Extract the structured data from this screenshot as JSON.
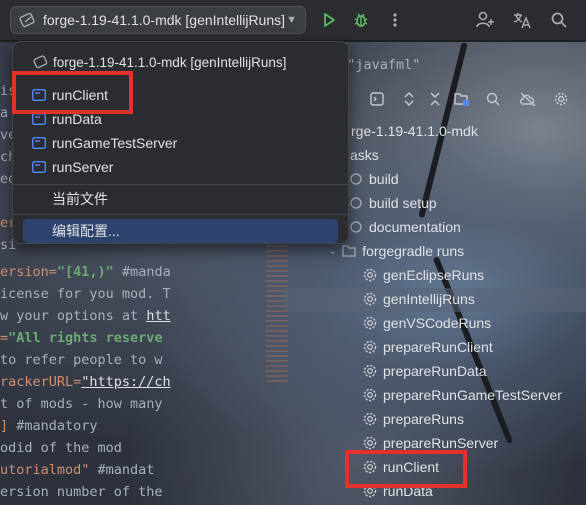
{
  "toolbar": {
    "run_config_label": "forge-1.19-41.1.0-mdk [genIntellijRuns]",
    "icons": [
      "run-config-icon",
      "chevron-down-icon",
      "run-icon",
      "debug-icon",
      "more-vert-icon",
      "add-user-icon",
      "translate-icon",
      "search-icon"
    ]
  },
  "popup": {
    "header": "forge-1.19-41.1.0-mdk [genIntellijRuns]",
    "items": [
      {
        "label": "runClient"
      },
      {
        "label": "runData"
      },
      {
        "label": "runGameTestServer"
      },
      {
        "label": "runServer"
      }
    ],
    "current_file": "当前文件",
    "edit_configurations": "编辑配置..."
  },
  "editor": {
    "lines": [
      {
        "text": "avaLoader=\"javafml\""
      },
      {
        "text": "is"
      },
      {
        "text": "a"
      },
      {
        "text": "ve"
      },
      {
        "text": "ch"
      },
      {
        "text": "ed"
      },
      {
        "text": "er"
      },
      {
        "text": "si"
      },
      {
        "prefix": "ersion=",
        "value": "\"[41,)\"",
        "suffix": " #manda"
      },
      {
        "text": "icense for you mod. T"
      },
      {
        "prefix": "w your options at ",
        "link": "htt"
      },
      {
        "prefix": "=",
        "value": "\"All rights reserve"
      },
      {
        "text": " to refer people to w"
      },
      {
        "prefix": "rackerURL=",
        "link": "\"https://ch"
      },
      {
        "text": "t of mods - how many"
      },
      {
        "orange": "]",
        "suffix": " #mandatory"
      },
      {
        "text": "odid of the mod"
      },
      {
        "orange": "utorialmod\"",
        "suffix": " #mandat"
      },
      {
        "text": "ersion number of the"
      }
    ]
  },
  "project_panel": {
    "root": "rge-1.19-41.1.0-mdk",
    "tasks_label": "asks",
    "items": [
      {
        "label": "build"
      },
      {
        "label": "build setup"
      },
      {
        "label": "documentation"
      },
      {
        "label": "forgegradle runs"
      },
      {
        "label": "genEclipseRuns"
      },
      {
        "label": "genIntellijRuns"
      },
      {
        "label": "genVSCodeRuns"
      },
      {
        "label": "prepareRunClient"
      },
      {
        "label": "prepareRunData"
      },
      {
        "label": "prepareRunGameTestServer"
      },
      {
        "label": "prepareRuns"
      },
      {
        "label": "prepareRunServer"
      },
      {
        "label": "runClient"
      },
      {
        "label": "runData"
      }
    ]
  },
  "colors": {
    "highlight_red": "#e5312b",
    "selection_blue": "#2e436e",
    "run_green": "#5fb865",
    "config_icon_blue": "#548af7"
  }
}
